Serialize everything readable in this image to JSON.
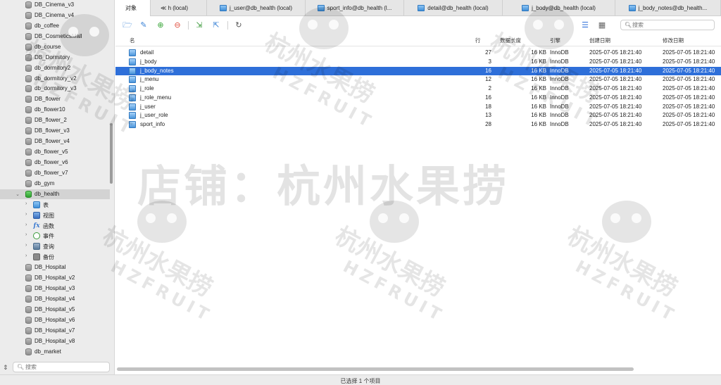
{
  "sidebar": {
    "databases_top": [
      "DB_Cinema_v3",
      "DB_Cinema_v4",
      "db_coffee",
      "DB_CosmeticsMall",
      "db_course",
      "DB_Dormitory",
      "db_dormitory2",
      "db_dormitory_v2",
      "db_dormitory_v3",
      "DB_flower",
      "db_flower10",
      "DB_flower_2",
      "DB_flower_v3",
      "DB_flower_v4",
      "db_flower_v5",
      "db_flower_v6",
      "db_flower_v7",
      "db_gym"
    ],
    "open_database": "db_health",
    "open_children": [
      {
        "label": "表",
        "icon": "table-icon"
      },
      {
        "label": "视图",
        "icon": "view-icon"
      },
      {
        "label": "函数",
        "icon": "function-icon"
      },
      {
        "label": "事件",
        "icon": "event-icon"
      },
      {
        "label": "查询",
        "icon": "query-icon"
      },
      {
        "label": "备份",
        "icon": "backup-icon"
      }
    ],
    "databases_bottom": [
      "DB_Hospital",
      "DB_Hospital_v2",
      "DB_Hospital_v3",
      "DB_Hospital_v4",
      "DB_Hospital_v5",
      "DB_Hospital_v6",
      "DB_Hospital_v7",
      "DB_Hospital_v8",
      "db_market"
    ],
    "search_placeholder": "搜索"
  },
  "tabs": [
    {
      "label": "对象",
      "active": true
    },
    {
      "label": "≪ h (local)",
      "icon": false
    },
    {
      "label": "j_user@db_health (local)",
      "icon": true
    },
    {
      "label": "sport_info@db_health (l...",
      "icon": true
    },
    {
      "label": "detail@db_health (local)",
      "icon": true
    },
    {
      "label": "j_body@db_health (local)",
      "icon": true
    },
    {
      "label": "j_body_notes@db_health...",
      "icon": true
    }
  ],
  "toolbar": {
    "search_placeholder": "搜索",
    "colors": {
      "open": "#3a82d6",
      "edit": "#3a82d6",
      "add": "#3aa63a",
      "delete": "#e04a3a"
    }
  },
  "columns": {
    "name": "名",
    "rows": "行",
    "data_length": "数据长度",
    "engine": "引擎",
    "created": "创建日期",
    "modified": "修改日期"
  },
  "tables": [
    {
      "name": "detail",
      "rows": "27",
      "size": "16 KB",
      "engine": "InnoDB",
      "created": "2025-07-05 18:21:40",
      "modified": "2025-07-05 18:21:40"
    },
    {
      "name": "j_body",
      "rows": "3",
      "size": "16 KB",
      "engine": "InnoDB",
      "created": "2025-07-05 18:21:40",
      "modified": "2025-07-05 18:21:40"
    },
    {
      "name": "j_body_notes",
      "rows": "16",
      "size": "16 KB",
      "engine": "InnoDB",
      "created": "2025-07-05 18:21:40",
      "modified": "2025-07-05 18:21:40",
      "selected": true
    },
    {
      "name": "j_menu",
      "rows": "12",
      "size": "16 KB",
      "engine": "InnoDB",
      "created": "2025-07-05 18:21:40",
      "modified": "2025-07-05 18:21:40"
    },
    {
      "name": "j_role",
      "rows": "2",
      "size": "16 KB",
      "engine": "InnoDB",
      "created": "2025-07-05 18:21:40",
      "modified": "2025-07-05 18:21:40"
    },
    {
      "name": "j_role_menu",
      "rows": "16",
      "size": "16 KB",
      "engine": "InnoDB",
      "created": "2025-07-05 18:21:40",
      "modified": "2025-07-05 18:21:40"
    },
    {
      "name": "j_user",
      "rows": "18",
      "size": "16 KB",
      "engine": "InnoDB",
      "created": "2025-07-05 18:21:40",
      "modified": "2025-07-05 18:21:40"
    },
    {
      "name": "j_user_role",
      "rows": "13",
      "size": "16 KB",
      "engine": "InnoDB",
      "created": "2025-07-05 18:21:40",
      "modified": "2025-07-05 18:21:40"
    },
    {
      "name": "sport_info",
      "rows": "28",
      "size": "16 KB",
      "engine": "InnoDB",
      "created": "2025-07-05 18:21:40",
      "modified": "2025-07-05 18:21:40"
    }
  ],
  "status": "已选择 1 个项目",
  "watermark": {
    "big_text": "店铺：杭州水果捞",
    "logo_cn": "杭州水果捞",
    "logo_en": "HZFRUIT"
  },
  "colors": {
    "selection": "#2e6fd9",
    "sidebar_bg": "#ececec"
  }
}
